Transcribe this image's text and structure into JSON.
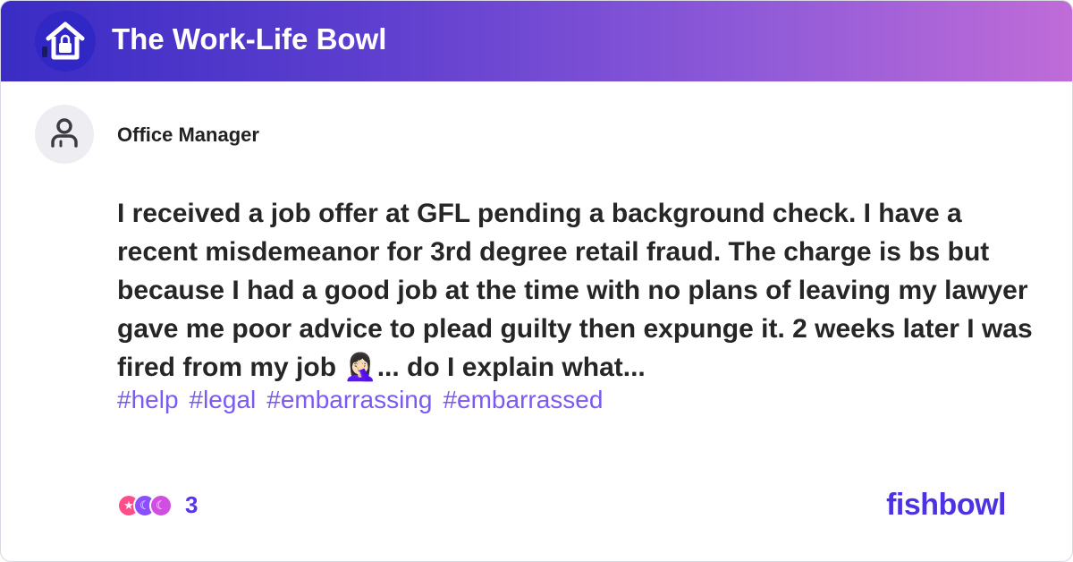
{
  "header": {
    "logo_icon": "house-lock-icon",
    "title": "The Work-Life Bowl"
  },
  "post": {
    "avatar_icon": "user-icon",
    "author": "Office Manager",
    "text": "I received a job offer at GFL pending a background check. I have a recent misdemeanor for 3rd degree retail fraud. The charge is bs but because I had a good job at the time with no plans of leaving my lawyer gave me poor advice to plead guilty then expunge it. 2 weeks later I was fired from my job 🤦🏻‍♀️... do I explain what...",
    "tags": [
      "#help",
      "#legal",
      "#embarrassing",
      "#embarrassed"
    ]
  },
  "footer": {
    "reaction_icons": [
      "star-reaction-icon",
      "moon-reaction-icon",
      "moon-reaction-icon"
    ],
    "reaction_count": "3",
    "brand": "fishbowl"
  },
  "colors": {
    "header_gradient_start": "#3a2cc4",
    "header_gradient_end": "#c06cd8",
    "tag": "#7a5af0",
    "brand": "#4b33e3"
  }
}
